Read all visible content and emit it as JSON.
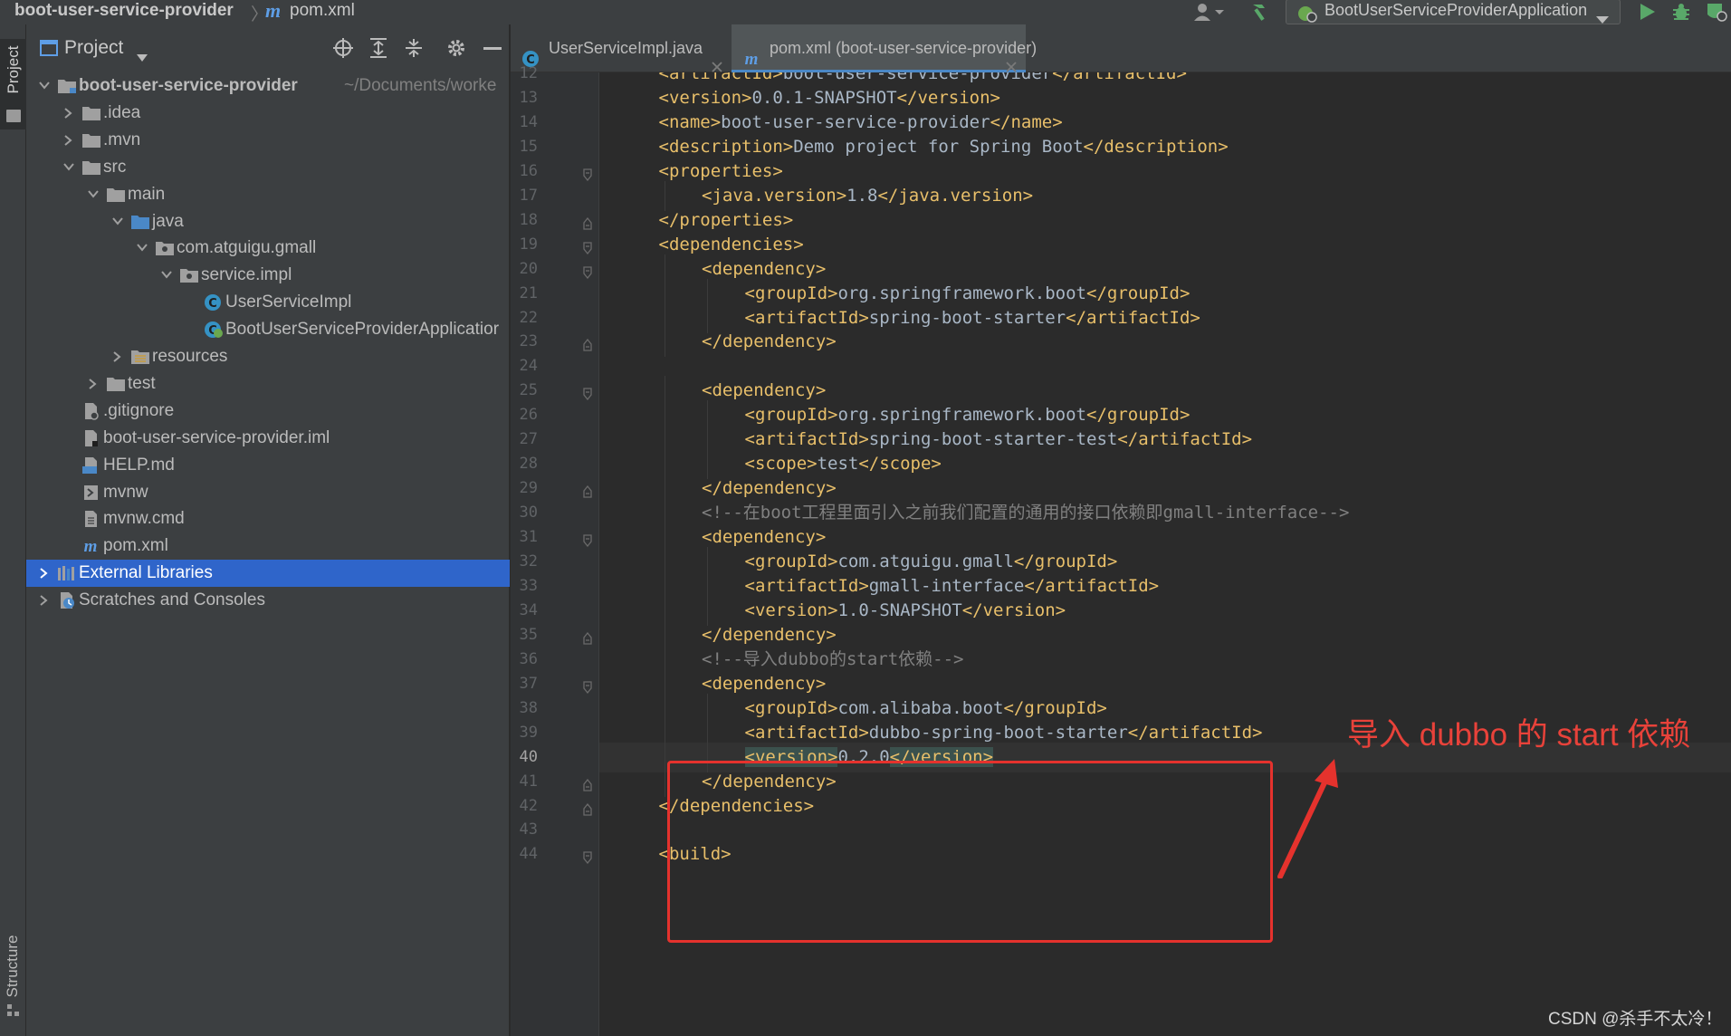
{
  "breadcrumb": {
    "project": "boot-user-service-provider",
    "file_icon": "m",
    "file": "pom.xml"
  },
  "toolbar": {
    "run_config": "BootUserServiceProviderApplication"
  },
  "stripe": {
    "project_label": "Project",
    "structure_label": "Structure"
  },
  "project_panel": {
    "title": "Project",
    "tree": [
      {
        "label": "boot-user-service-provider",
        "suffix": "~/Documents/worke",
        "icon": "module-folder-icon",
        "arrow": "down",
        "bold": true
      },
      {
        "label": ".idea",
        "icon": "folder-icon",
        "arrow": "right"
      },
      {
        "label": ".mvn",
        "icon": "folder-icon",
        "arrow": "right"
      },
      {
        "label": "src",
        "icon": "folder-icon",
        "arrow": "down"
      },
      {
        "label": "main",
        "icon": "folder-icon",
        "arrow": "down"
      },
      {
        "label": "java",
        "icon": "source-folder-icon",
        "arrow": "down"
      },
      {
        "label": "com.atguigu.gmall",
        "icon": "package-icon",
        "arrow": "down"
      },
      {
        "label": "service.impl",
        "icon": "package-icon",
        "arrow": "down"
      },
      {
        "label": "UserServiceImpl",
        "icon": "class-icon",
        "arrow": ""
      },
      {
        "label": "BootUserServiceProviderApplicatior",
        "icon": "spring-boot-class-icon",
        "arrow": ""
      },
      {
        "label": "resources",
        "icon": "resources-folder-icon",
        "arrow": "right"
      },
      {
        "label": "test",
        "icon": "folder-icon",
        "arrow": "right"
      },
      {
        "label": ".gitignore",
        "icon": "ignore-file-icon",
        "arrow": ""
      },
      {
        "label": "boot-user-service-provider.iml",
        "icon": "iml-file-icon",
        "arrow": ""
      },
      {
        "label": "HELP.md",
        "icon": "markdown-file-icon",
        "arrow": ""
      },
      {
        "label": "mvnw",
        "icon": "shell-script-icon",
        "arrow": ""
      },
      {
        "label": "mvnw.cmd",
        "icon": "text-file-icon",
        "arrow": ""
      },
      {
        "label": "pom.xml",
        "icon": "maven-file-icon",
        "arrow": ""
      },
      {
        "label": "External Libraries",
        "icon": "library-icon",
        "arrow": "right",
        "selected": true
      },
      {
        "label": "Scratches and Consoles",
        "icon": "scratches-icon",
        "arrow": "right"
      }
    ]
  },
  "tabs": [
    {
      "label": "UserServiceImpl.java",
      "icon": "class-icon",
      "active": false
    },
    {
      "label": "pom.xml (boot-user-service-provider)",
      "icon": "maven-file-icon",
      "active": true
    }
  ],
  "editor": {
    "current_line": "40",
    "lines": [
      {
        "n": "12",
        "indent": 1,
        "parts": [
          {
            "t": "tag",
            "v": "<artifactId>"
          },
          {
            "t": "txt",
            "v": "boot-user-service-provider"
          },
          {
            "t": "tag",
            "v": "</artifactId>"
          }
        ]
      },
      {
        "n": "13",
        "indent": 1,
        "parts": [
          {
            "t": "tag",
            "v": "<version>"
          },
          {
            "t": "txt",
            "v": "0.0.1-SNAPSHOT"
          },
          {
            "t": "tag",
            "v": "</version>"
          }
        ]
      },
      {
        "n": "14",
        "indent": 1,
        "parts": [
          {
            "t": "tag",
            "v": "<name>"
          },
          {
            "t": "txt",
            "v": "boot-user-service-provider"
          },
          {
            "t": "tag",
            "v": "</name>"
          }
        ]
      },
      {
        "n": "15",
        "indent": 1,
        "parts": [
          {
            "t": "tag",
            "v": "<description>"
          },
          {
            "t": "txt",
            "v": "Demo project for Spring Boot"
          },
          {
            "t": "tag",
            "v": "</description>"
          }
        ]
      },
      {
        "n": "16",
        "indent": 1,
        "fold": "open",
        "parts": [
          {
            "t": "tag",
            "v": "<properties>"
          }
        ]
      },
      {
        "n": "17",
        "indent": 2,
        "parts": [
          {
            "t": "tag",
            "v": "<java.version>"
          },
          {
            "t": "txt",
            "v": "1.8"
          },
          {
            "t": "tag",
            "v": "</java.version>"
          }
        ]
      },
      {
        "n": "18",
        "indent": 1,
        "fold": "close",
        "parts": [
          {
            "t": "tag",
            "v": "</properties>"
          }
        ]
      },
      {
        "n": "19",
        "indent": 1,
        "fold": "open",
        "parts": [
          {
            "t": "tag",
            "v": "<dependencies>"
          }
        ]
      },
      {
        "n": "20",
        "indent": 2,
        "fold": "open",
        "parts": [
          {
            "t": "tag",
            "v": "<dependency>"
          }
        ]
      },
      {
        "n": "21",
        "indent": 3,
        "parts": [
          {
            "t": "tag",
            "v": "<groupId>"
          },
          {
            "t": "txt",
            "v": "org.springframework.boot"
          },
          {
            "t": "tag",
            "v": "</groupId>"
          }
        ]
      },
      {
        "n": "22",
        "indent": 3,
        "parts": [
          {
            "t": "tag",
            "v": "<artifactId>"
          },
          {
            "t": "txt",
            "v": "spring-boot-starter"
          },
          {
            "t": "tag",
            "v": "</artifactId>"
          }
        ]
      },
      {
        "n": "23",
        "indent": 2,
        "fold": "close",
        "parts": [
          {
            "t": "tag",
            "v": "</dependency>"
          }
        ]
      },
      {
        "n": "24",
        "indent": 0,
        "parts": []
      },
      {
        "n": "25",
        "indent": 2,
        "fold": "open",
        "parts": [
          {
            "t": "tag",
            "v": "<dependency>"
          }
        ]
      },
      {
        "n": "26",
        "indent": 3,
        "parts": [
          {
            "t": "tag",
            "v": "<groupId>"
          },
          {
            "t": "txt",
            "v": "org.springframework.boot"
          },
          {
            "t": "tag",
            "v": "</groupId>"
          }
        ]
      },
      {
        "n": "27",
        "indent": 3,
        "parts": [
          {
            "t": "tag",
            "v": "<artifactId>"
          },
          {
            "t": "txt",
            "v": "spring-boot-starter-test"
          },
          {
            "t": "tag",
            "v": "</artifactId>"
          }
        ]
      },
      {
        "n": "28",
        "indent": 3,
        "parts": [
          {
            "t": "tag",
            "v": "<scope>"
          },
          {
            "t": "txt",
            "v": "test"
          },
          {
            "t": "tag",
            "v": "</scope>"
          }
        ]
      },
      {
        "n": "29",
        "indent": 2,
        "fold": "close",
        "parts": [
          {
            "t": "tag",
            "v": "</dependency>"
          }
        ]
      },
      {
        "n": "30",
        "indent": 2,
        "parts": [
          {
            "t": "cmt",
            "v": "<!--在boot工程里面引入之前我们配置的通用的接口依赖即gmall-interface-->"
          }
        ]
      },
      {
        "n": "31",
        "indent": 2,
        "fold": "open",
        "parts": [
          {
            "t": "tag",
            "v": "<dependency>"
          }
        ]
      },
      {
        "n": "32",
        "indent": 3,
        "parts": [
          {
            "t": "tag",
            "v": "<groupId>"
          },
          {
            "t": "txt",
            "v": "com.atguigu.gmall"
          },
          {
            "t": "tag",
            "v": "</groupId>"
          }
        ]
      },
      {
        "n": "33",
        "indent": 3,
        "parts": [
          {
            "t": "tag",
            "v": "<artifactId>"
          },
          {
            "t": "txt",
            "v": "gmall-interface"
          },
          {
            "t": "tag",
            "v": "</artifactId>"
          }
        ]
      },
      {
        "n": "34",
        "indent": 3,
        "parts": [
          {
            "t": "tag",
            "v": "<version>"
          },
          {
            "t": "txt",
            "v": "1.0-SNAPSHOT"
          },
          {
            "t": "tag",
            "v": "</version>"
          }
        ]
      },
      {
        "n": "35",
        "indent": 2,
        "fold": "close",
        "parts": [
          {
            "t": "tag",
            "v": "</dependency>"
          }
        ]
      },
      {
        "n": "36",
        "indent": 2,
        "parts": [
          {
            "t": "cmt",
            "v": "<!--导入dubbo的start依赖-->"
          }
        ]
      },
      {
        "n": "37",
        "indent": 2,
        "fold": "open",
        "parts": [
          {
            "t": "tag",
            "v": "<dependency>"
          }
        ]
      },
      {
        "n": "38",
        "indent": 3,
        "parts": [
          {
            "t": "tag",
            "v": "<groupId>"
          },
          {
            "t": "txt",
            "v": "com.alibaba.boot"
          },
          {
            "t": "tag",
            "v": "</groupId>"
          }
        ]
      },
      {
        "n": "39",
        "indent": 3,
        "parts": [
          {
            "t": "tag",
            "v": "<artifactId>"
          },
          {
            "t": "txt",
            "v": "dubbo-spring-boot-starter"
          },
          {
            "t": "tag",
            "v": "</artifactId>"
          }
        ]
      },
      {
        "n": "40",
        "indent": 3,
        "parts": [
          {
            "t": "taghl",
            "v": "<version>"
          },
          {
            "t": "txt",
            "v": "0.2.0"
          },
          {
            "t": "taghl",
            "v": "</version>"
          }
        ]
      },
      {
        "n": "41",
        "indent": 2,
        "fold": "close",
        "parts": [
          {
            "t": "tag",
            "v": "</dependency>"
          }
        ]
      },
      {
        "n": "42",
        "indent": 1,
        "fold": "close",
        "parts": [
          {
            "t": "tag",
            "v": "</dependencies>"
          }
        ]
      },
      {
        "n": "43",
        "indent": 0,
        "parts": []
      },
      {
        "n": "44",
        "indent": 1,
        "fold": "open",
        "parts": [
          {
            "t": "tag",
            "v": "<build>"
          }
        ]
      }
    ]
  },
  "annotation": {
    "text": "导入 dubbo 的 start 依赖",
    "color": "#e5322d"
  },
  "watermark": "CSDN @杀手不太冷！",
  "colors": {
    "tag": "#e8bf6a",
    "text": "#a9b7c6",
    "comment": "#808080",
    "selection": "#2f65ca",
    "background": "#2b2b2b",
    "panel": "#3c3f41"
  }
}
